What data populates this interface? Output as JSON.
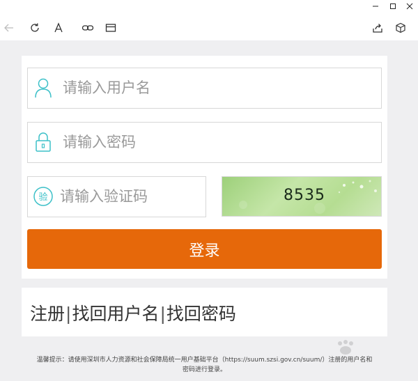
{
  "login": {
    "username_placeholder": "请输入用户名",
    "password_placeholder": "请输入密码",
    "captcha_placeholder": "请输入验证码",
    "captcha_icon_label": "验",
    "captcha_code": "8535",
    "login_label": "登录"
  },
  "links": {
    "register": "注册",
    "separator": "|",
    "find_username": "找回用户名",
    "find_password": "找回密码"
  },
  "notice": {
    "line1": "温馨提示：请使用深圳市人力资源和社会保障局统一用户基础平台（https://suum.szsi.gov.cn/suum/）注册的用户名和",
    "line2": "密码进行登录。"
  },
  "colors": {
    "accent": "#e6680a",
    "icon_teal": "#3cc0c8"
  },
  "icons": {
    "back": "arrow-left-icon",
    "refresh": "refresh-icon",
    "font": "font-icon",
    "link": "link-icon",
    "window": "window-icon",
    "share": "share-icon",
    "cube": "cube-icon"
  }
}
